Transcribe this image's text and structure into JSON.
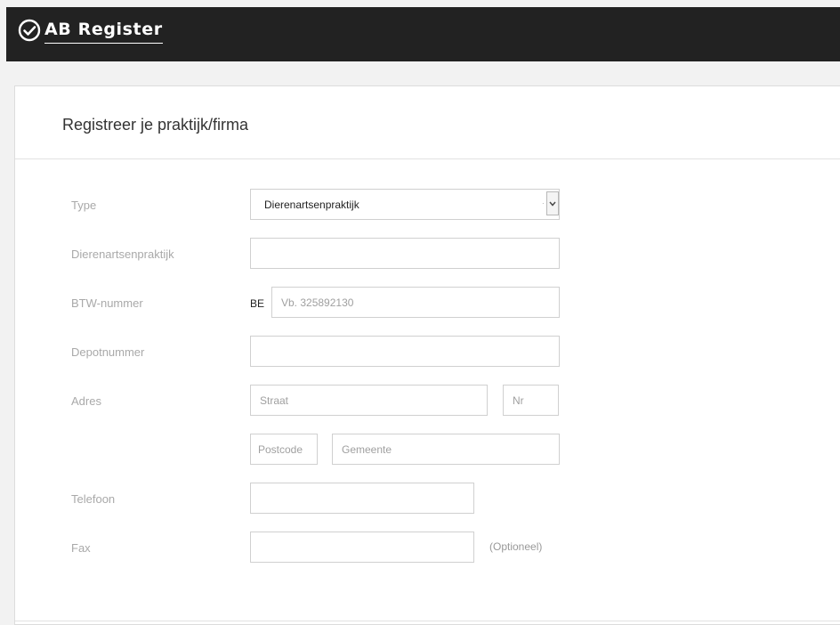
{
  "header": {
    "logo_text": "AB Register",
    "logo_icon": "check-circle-icon"
  },
  "form": {
    "title": "Registreer je praktijk/firma",
    "type": {
      "label": "Type",
      "selected": "Dierenartsenpraktijk"
    },
    "practice_name": {
      "label": "Dierenartsenpraktijk",
      "value": "",
      "placeholder": ""
    },
    "vat": {
      "label": "BTW-nummer",
      "prefix": "BE",
      "value": "",
      "placeholder": "Vb. 325892130"
    },
    "depot": {
      "label": "Depotnummer",
      "value": "",
      "placeholder": ""
    },
    "address": {
      "label": "Adres",
      "street_placeholder": "Straat",
      "number_placeholder": "Nr",
      "postcode_placeholder": "Postcode",
      "city_placeholder": "Gemeente"
    },
    "phone": {
      "label": "Telefoon",
      "value": "",
      "placeholder": ""
    },
    "fax": {
      "label": "Fax",
      "value": "",
      "placeholder": "",
      "hint": "(Optioneel)"
    }
  }
}
